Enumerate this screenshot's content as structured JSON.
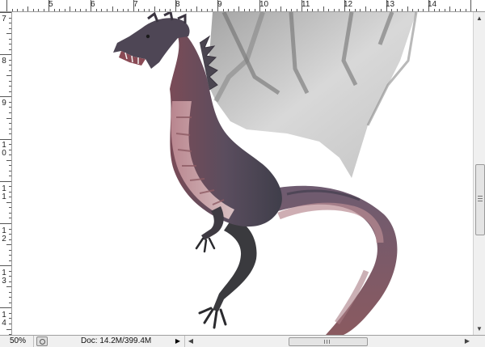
{
  "ruler": {
    "top_labels": [
      "5",
      "6",
      "7",
      "8",
      "9",
      "10",
      "11",
      "12",
      "13",
      "14"
    ],
    "left_labels": [
      "7",
      "8",
      "9",
      "10",
      "11",
      "12",
      "13",
      "14"
    ]
  },
  "status": {
    "zoom": "50%",
    "doc_info": "Doc: 14.2M/399.4M"
  },
  "icons": {
    "status_menu": "right-triangle-icon",
    "scroll_up": "up-arrow-icon",
    "scroll_down": "down-arrow-icon",
    "scroll_left": "left-arrow-icon",
    "scroll_right": "right-arrow-icon"
  },
  "colors": {
    "ui_background": "#f0f0f0",
    "canvas_background": "#ffffff"
  }
}
